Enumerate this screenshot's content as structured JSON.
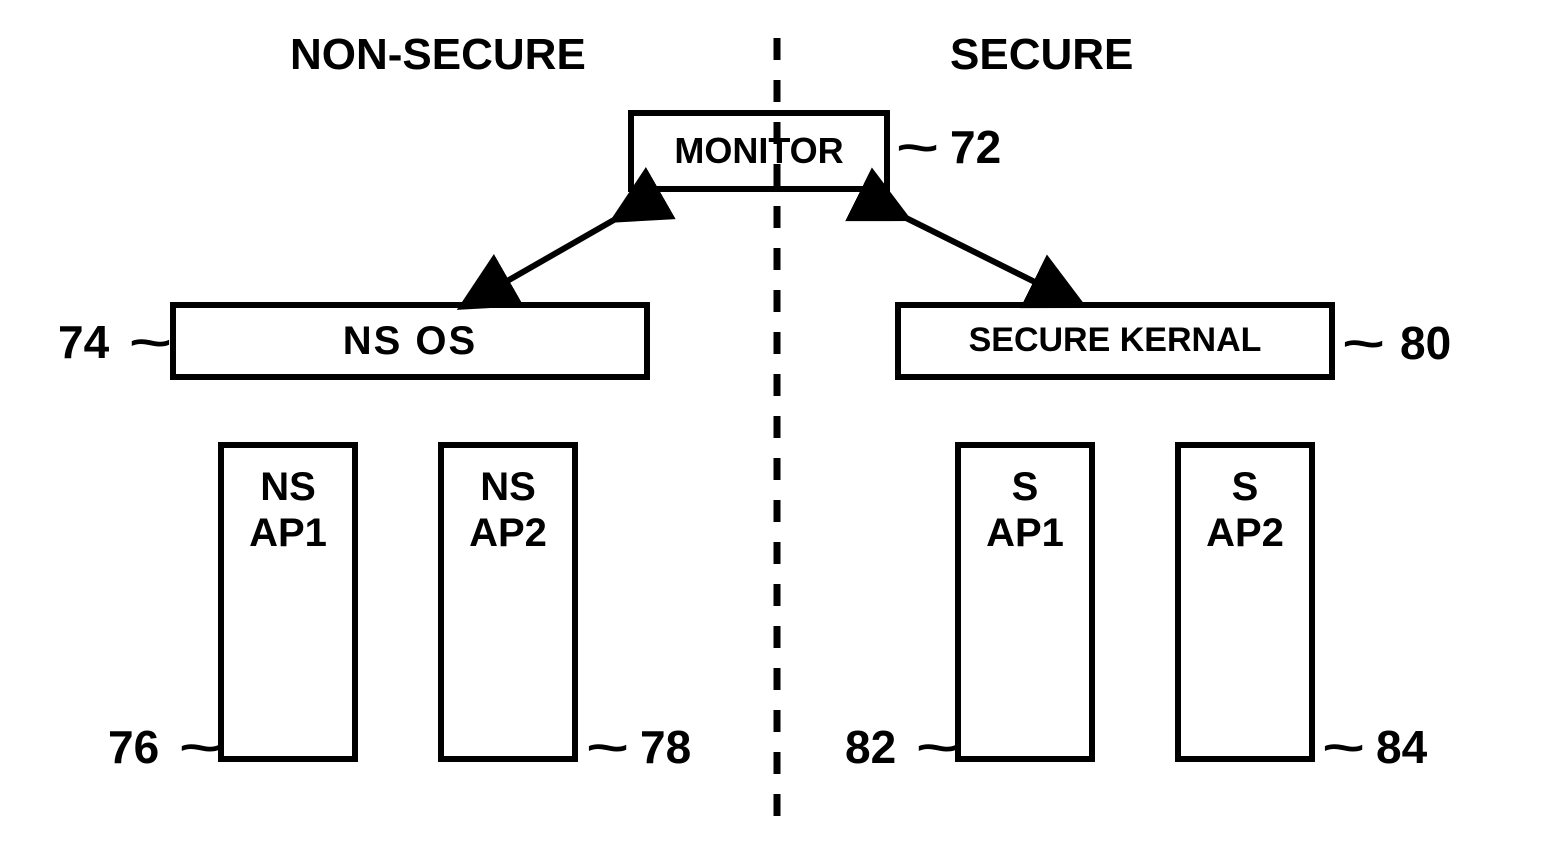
{
  "headers": {
    "non_secure": "NON-SECURE",
    "secure": "SECURE"
  },
  "boxes": {
    "monitor": "MONITOR",
    "ns_os": "NS OS",
    "secure_kernal": "SECURE KERNAL",
    "ns_ap1_line1": "NS",
    "ns_ap1_line2": "AP1",
    "ns_ap2_line1": "NS",
    "ns_ap2_line2": "AP2",
    "s_ap1_line1": "S",
    "s_ap1_line2": "AP1",
    "s_ap2_line1": "S",
    "s_ap2_line2": "AP2"
  },
  "refs": {
    "r72": "72",
    "r74": "74",
    "r76": "76",
    "r78": "78",
    "r80": "80",
    "r82": "82",
    "r84": "84"
  }
}
